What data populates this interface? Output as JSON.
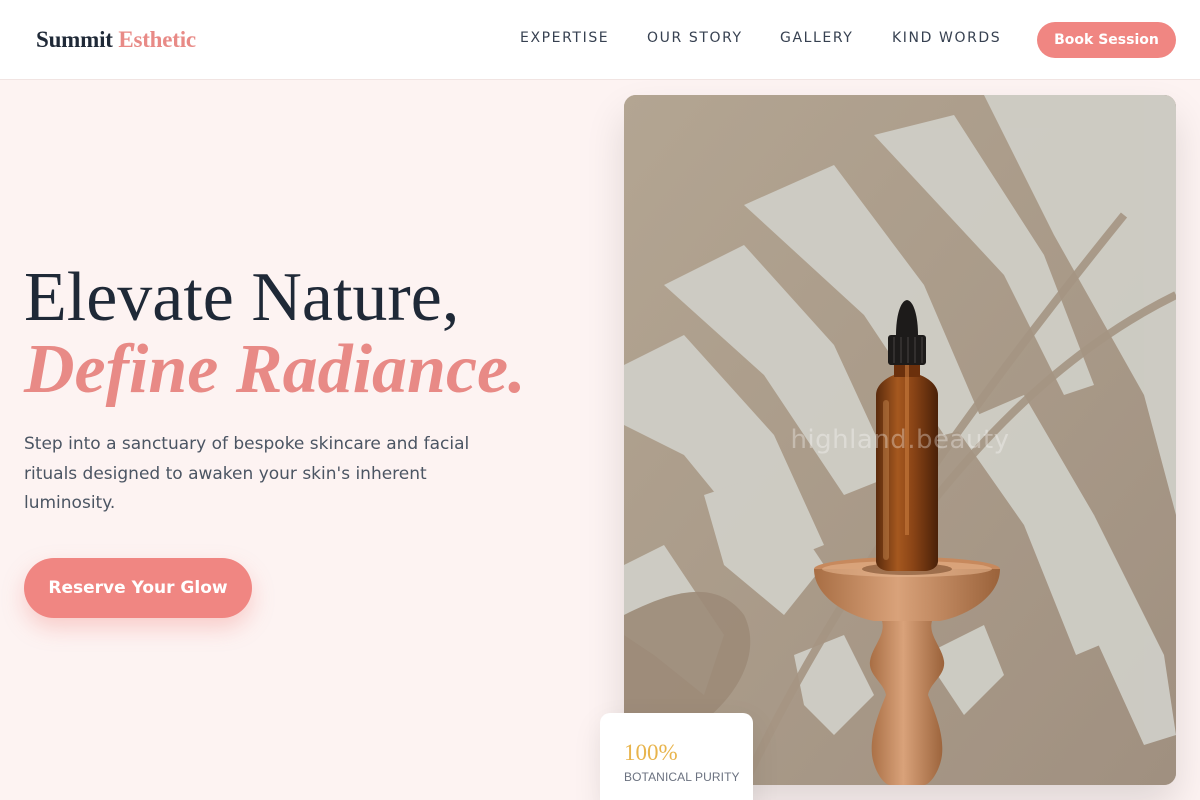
{
  "brand": {
    "name_part1": "Summit",
    "name_part2": "Esthetic",
    "accent_color": "#e88a86"
  },
  "nav": {
    "items": [
      {
        "label": "EXPERTISE"
      },
      {
        "label": "OUR STORY"
      },
      {
        "label": "GALLERY"
      },
      {
        "label": "KIND WORDS"
      }
    ],
    "cta_label": "Book Session"
  },
  "hero": {
    "title_line1": "Elevate Nature,",
    "title_line2": "Define Radiance.",
    "description": "Step into a sanctuary of bespoke skincare and facial rituals designed to awaken your skin's inherent luminosity.",
    "cta_label": "Reserve Your Glow",
    "image_watermark": "highland.beauty"
  },
  "stat": {
    "value": "100%",
    "label": "BOTANICAL PURITY"
  },
  "colors": {
    "primary_button": "#f08682",
    "page_background": "#fdf3f2",
    "stat_accent": "#e8b44c"
  }
}
